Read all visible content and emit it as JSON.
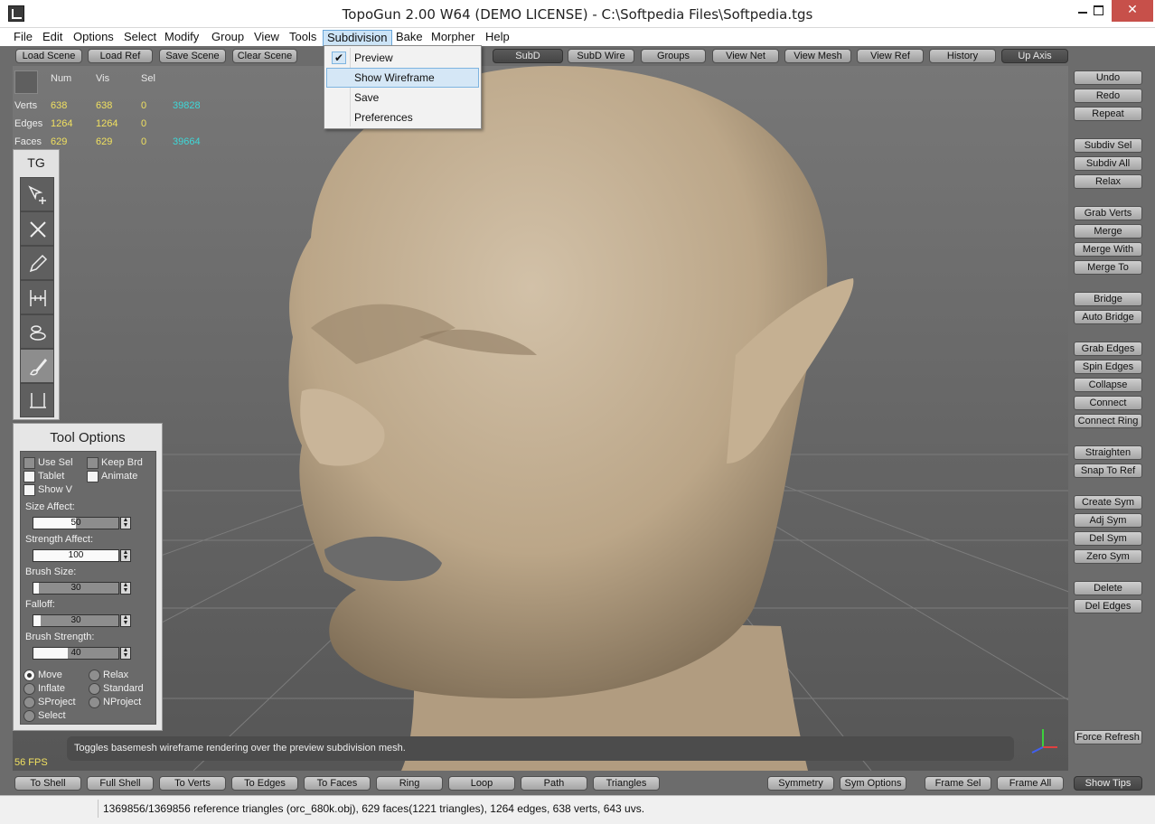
{
  "window": {
    "title": "TopoGun 2.00 W64  (DEMO LICENSE)  - C:\\Softpedia Files\\Softpedia.tgs",
    "minimize": "",
    "maximize": "",
    "close": "✕"
  },
  "menubar": {
    "items": [
      "File",
      "Edit",
      "Options",
      "Select",
      "Modify",
      "Group",
      "View",
      "Tools",
      "Subdivision",
      "Bake",
      "Morpher",
      "Help"
    ]
  },
  "dropdown": {
    "items": [
      "Preview",
      "Show Wireframe",
      "Save",
      "Preferences"
    ],
    "checked": "✔"
  },
  "toolbar_top": {
    "items": [
      "Load Scene",
      "Load Ref",
      "Save Scene",
      "Clear Scene",
      "SubD",
      "SubD Wire",
      "Groups",
      "View Net",
      "View Mesh",
      "View Ref",
      "History",
      "Up Axis"
    ]
  },
  "stats": {
    "headers": [
      "Num",
      "Vis",
      "Sel"
    ],
    "rows": [
      {
        "label": "Verts",
        "num": "638",
        "vis": "638",
        "sel": "0",
        "extra": "39828"
      },
      {
        "label": "Edges",
        "num": "1264",
        "vis": "1264",
        "sel": "0",
        "extra": ""
      },
      {
        "label": "Faces",
        "num": "629",
        "vis": "629",
        "sel": "0",
        "extra": "39664"
      }
    ]
  },
  "tg_panel": {
    "title": "TG"
  },
  "tool_options": {
    "title": "Tool Options",
    "checkboxes": [
      "Use Sel",
      "Keep Brd",
      "Tablet",
      "Animate",
      "Show V"
    ],
    "fields": [
      {
        "label": "Size Affect:",
        "value": "50",
        "fill": 0.5
      },
      {
        "label": "Strength Affect:",
        "value": "100",
        "fill": 1.0
      },
      {
        "label": "Brush Size:",
        "value": "30",
        "fill": 0.06
      },
      {
        "label": "Falloff:",
        "value": "30",
        "fill": 0.08
      },
      {
        "label": "Brush Strength:",
        "value": "40",
        "fill": 0.4
      }
    ],
    "radios": [
      "Move",
      "Relax",
      "Inflate",
      "Standard",
      "SProject",
      "NProject",
      "Select"
    ],
    "selected_radio": "Move"
  },
  "right_panel": {
    "items": [
      "Undo",
      "Redo",
      "Repeat",
      "Subdiv Sel",
      "Subdiv All",
      "Relax",
      "Grab Verts",
      "Merge",
      "Merge With",
      "Merge To",
      "Bridge",
      "Auto Bridge",
      "Grab Edges",
      "Spin Edges",
      "Collapse",
      "Connect",
      "Connect Ring",
      "Straighten",
      "Snap To Ref",
      "Create Sym",
      "Adj Sym",
      "Del Sym",
      "Zero Sym",
      "Delete",
      "Del Edges",
      "Force Refresh"
    ]
  },
  "tooltip": "Toggles basemesh wireframe rendering over the preview subdivision mesh.",
  "fps": "56 FPS",
  "bottom_bar": {
    "items": [
      "To Shell",
      "Full Shell",
      "To Verts",
      "To Edges",
      "To Faces",
      "Ring",
      "Loop",
      "Path",
      "Triangles",
      "Symmetry",
      "Sym Options",
      "Frame Sel",
      "Frame All",
      "Show Tips"
    ]
  },
  "statusbar": {
    "text": "1369856/1369856 reference triangles (orc_680k.obj), 629 faces(1221 triangles), 1264 edges, 638 verts, 643 uvs."
  },
  "colors": {
    "skin": "#c7b49a",
    "stat_yellow": "#f0e060",
    "stat_cyan": "#3ed8d8",
    "close_red": "#c7504a"
  }
}
